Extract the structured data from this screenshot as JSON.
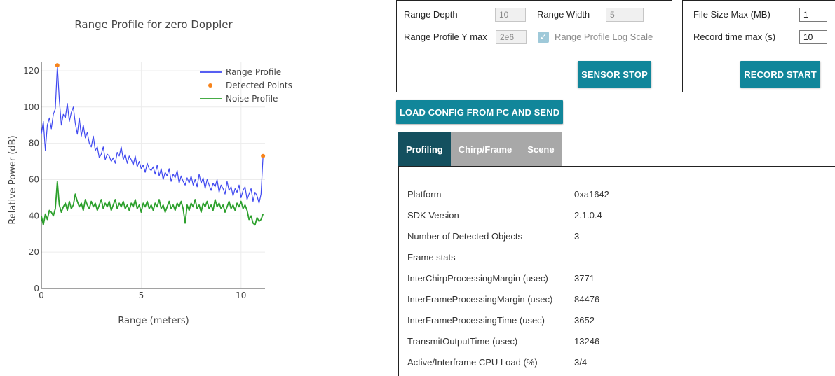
{
  "chart_data": {
    "type": "line",
    "title": "Range Profile for zero Doppler",
    "xlabel": "Range (meters)",
    "ylabel": "Relative Power (dB)",
    "xlim": [
      0,
      11.2
    ],
    "ylim": [
      0,
      125
    ],
    "xticks": [
      0,
      5,
      10
    ],
    "yticks": [
      0,
      20,
      40,
      60,
      80,
      100,
      120
    ],
    "grid": true,
    "legend_position": "top-right",
    "series": [
      {
        "name": "Range Profile",
        "color": "#3f48f0",
        "x": [
          0.0,
          0.1,
          0.2,
          0.3,
          0.4,
          0.5,
          0.6,
          0.7,
          0.8,
          0.9,
          1.0,
          1.1,
          1.2,
          1.3,
          1.4,
          1.5,
          1.6,
          1.7,
          1.8,
          1.9,
          2.0,
          2.1,
          2.2,
          2.3,
          2.4,
          2.5,
          2.6,
          2.7,
          2.8,
          2.9,
          3.0,
          3.1,
          3.2,
          3.3,
          3.4,
          3.5,
          3.6,
          3.7,
          3.8,
          3.9,
          4.0,
          4.1,
          4.2,
          4.3,
          4.4,
          4.5,
          4.6,
          4.7,
          4.8,
          4.9,
          5.0,
          5.1,
          5.2,
          5.3,
          5.4,
          5.5,
          5.6,
          5.7,
          5.8,
          5.9,
          6.0,
          6.1,
          6.2,
          6.3,
          6.4,
          6.5,
          6.6,
          6.7,
          6.8,
          6.9,
          7.0,
          7.1,
          7.2,
          7.3,
          7.4,
          7.5,
          7.6,
          7.7,
          7.8,
          7.9,
          8.0,
          8.1,
          8.2,
          8.3,
          8.4,
          8.5,
          8.6,
          8.7,
          8.8,
          8.9,
          9.0,
          9.1,
          9.2,
          9.3,
          9.4,
          9.5,
          9.6,
          9.7,
          9.8,
          9.9,
          10.0,
          10.1,
          10.2,
          10.3,
          10.4,
          10.5,
          10.6,
          10.7,
          10.8,
          10.9,
          11.0,
          11.1
        ],
        "y": [
          85,
          92,
          76,
          90,
          94,
          88,
          96,
          99,
          123,
          104,
          90,
          96,
          94,
          102,
          92,
          97,
          100,
          91,
          85,
          94,
          84,
          90,
          83,
          86,
          80,
          78,
          84,
          76,
          78,
          72,
          74,
          78,
          71,
          74,
          73,
          70,
          72,
          69,
          75,
          73,
          78,
          71,
          74,
          69,
          73,
          71,
          68,
          73,
          67,
          70,
          66,
          68,
          64,
          69,
          66,
          65,
          67,
          63,
          68,
          62,
          66,
          60,
          64,
          62,
          66,
          59,
          63,
          61,
          65,
          58,
          62,
          59,
          57,
          61,
          58,
          62,
          57,
          60,
          56,
          63,
          58,
          61,
          55,
          60,
          57,
          54,
          58,
          56,
          60,
          53,
          57,
          55,
          52,
          59,
          54,
          56,
          51,
          55,
          53,
          57,
          50,
          54,
          56,
          49,
          52,
          55,
          48,
          53,
          51,
          47,
          52,
          73
        ]
      },
      {
        "name": "Detected Points",
        "color": "#f7841c",
        "x": [
          0.8,
          11.1
        ],
        "y": [
          123,
          73
        ]
      },
      {
        "name": "Noise Profile",
        "color": "#2ca02c",
        "x": [
          0.0,
          0.1,
          0.2,
          0.3,
          0.4,
          0.5,
          0.6,
          0.7,
          0.8,
          0.9,
          1.0,
          1.1,
          1.2,
          1.3,
          1.4,
          1.5,
          1.6,
          1.7,
          1.8,
          1.9,
          2.0,
          2.1,
          2.2,
          2.3,
          2.4,
          2.5,
          2.6,
          2.7,
          2.8,
          2.9,
          3.0,
          3.1,
          3.2,
          3.3,
          3.4,
          3.5,
          3.6,
          3.7,
          3.8,
          3.9,
          4.0,
          4.1,
          4.2,
          4.3,
          4.4,
          4.5,
          4.6,
          4.7,
          4.8,
          4.9,
          5.0,
          5.1,
          5.2,
          5.3,
          5.4,
          5.5,
          5.6,
          5.7,
          5.8,
          5.9,
          6.0,
          6.1,
          6.2,
          6.3,
          6.4,
          6.5,
          6.6,
          6.7,
          6.8,
          6.9,
          7.0,
          7.1,
          7.2,
          7.3,
          7.4,
          7.5,
          7.6,
          7.7,
          7.8,
          7.9,
          8.0,
          8.1,
          8.2,
          8.3,
          8.4,
          8.5,
          8.6,
          8.7,
          8.8,
          8.9,
          9.0,
          9.1,
          9.2,
          9.3,
          9.4,
          9.5,
          9.6,
          9.7,
          9.8,
          9.9,
          10.0,
          10.1,
          10.2,
          10.3,
          10.4,
          10.5,
          10.6,
          10.7,
          10.8,
          10.9,
          11.0,
          11.1
        ],
        "y": [
          40,
          35,
          41,
          38,
          43,
          42,
          40,
          44,
          59,
          46,
          42,
          45,
          47,
          43,
          48,
          44,
          46,
          52,
          48,
          45,
          47,
          43,
          49,
          46,
          44,
          48,
          45,
          47,
          43,
          46,
          49,
          44,
          47,
          45,
          48,
          43,
          46,
          49,
          44,
          47,
          45,
          48,
          44,
          46,
          43,
          47,
          45,
          49,
          44,
          46,
          42,
          47,
          45,
          48,
          44,
          46,
          43,
          47,
          45,
          49,
          44,
          46,
          42,
          45,
          48,
          44,
          46,
          43,
          47,
          45,
          48,
          44,
          36,
          46,
          43,
          47,
          45,
          49,
          44,
          46,
          42,
          47,
          45,
          48,
          44,
          46,
          43,
          49,
          45,
          47,
          44,
          46,
          42,
          45,
          48,
          44,
          46,
          43,
          47,
          45,
          48,
          44,
          46,
          43,
          38,
          40,
          36,
          35,
          39,
          37,
          38,
          41
        ]
      }
    ]
  },
  "sensor_panel": {
    "range_depth_label": "Range Depth",
    "range_depth_value": "10",
    "range_width_label": "Range Width",
    "range_width_value": "5",
    "range_profile_ymax_label": "Range Profile Y max",
    "range_profile_ymax_value": "2e6",
    "log_scale_label": "Range Profile Log Scale",
    "log_scale_checked": true,
    "sensor_stop_label": "SENSOR STOP"
  },
  "record_panel": {
    "file_size_label": "File Size Max (MB)",
    "file_size_value": "1",
    "record_time_label": "Record time max (s)",
    "record_time_value": "10",
    "record_start_label": "RECORD START"
  },
  "load_config_label": "LOAD CONFIG FROM PC AND SEND",
  "tabs": [
    {
      "label": "Profiling",
      "active": true
    },
    {
      "label": "Chirp/Frame",
      "active": false
    },
    {
      "label": "Scene",
      "active": false
    }
  ],
  "stats": [
    {
      "key": "Platform",
      "value": "0xa1642"
    },
    {
      "key": "SDK Version",
      "value": "2.1.0.4"
    },
    {
      "key": "Number of Detected Objects",
      "value": "3"
    },
    {
      "key": "Frame stats",
      "value": ""
    },
    {
      "key": "InterChirpProcessingMargin (usec)",
      "value": "3771"
    },
    {
      "key": "InterFrameProcessingMargin (usec)",
      "value": "84476"
    },
    {
      "key": "InterFrameProcessingTime (usec)",
      "value": "3652"
    },
    {
      "key": "TransmitOutputTime (usec)",
      "value": "13246"
    },
    {
      "key": "Active/Interframe CPU Load (%)",
      "value": "3/4"
    }
  ]
}
